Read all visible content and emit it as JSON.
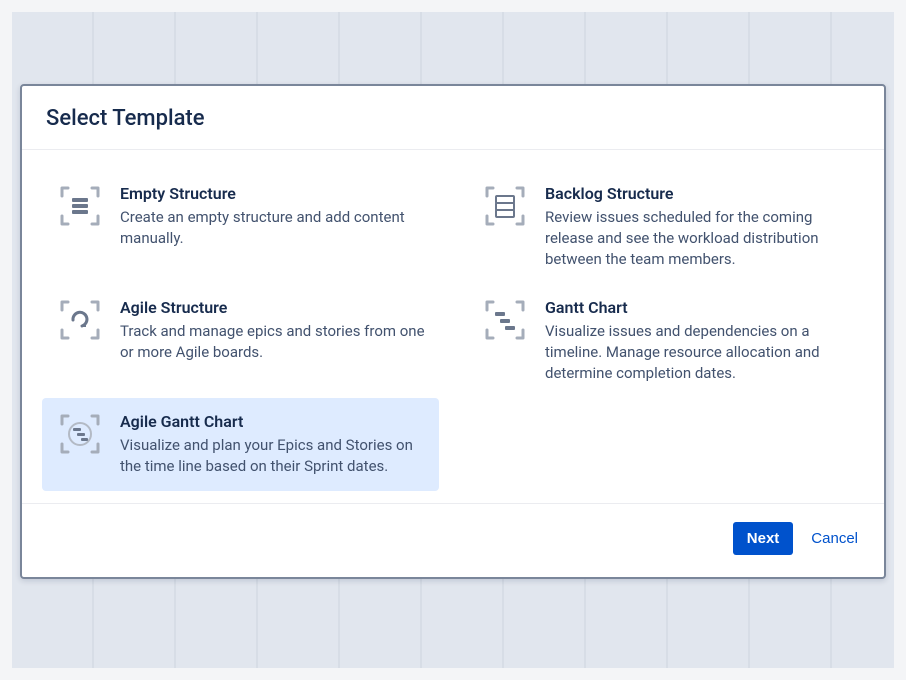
{
  "modal": {
    "title": "Select Template",
    "templates": [
      {
        "title": "Empty Structure",
        "desc": "Create an empty structure and add content manually.",
        "selected": false
      },
      {
        "title": "Backlog Structure",
        "desc": "Review issues scheduled for the coming release and see the workload distribution between the team members.",
        "selected": false
      },
      {
        "title": "Agile Structure",
        "desc": "Track and manage epics and stories from one or more Agile boards.",
        "selected": false
      },
      {
        "title": "Gantt Chart",
        "desc": "Visualize issues and dependencies on a timeline. Manage resource allocation and determine completion dates.",
        "selected": false
      },
      {
        "title": "Agile Gantt Chart",
        "desc": "Visualize and plan your Epics and Stories on the time line based on their Sprint dates.",
        "selected": true
      }
    ],
    "footer": {
      "next": "Next",
      "cancel": "Cancel"
    }
  },
  "colors": {
    "primary": "#0052cc",
    "selected_bg": "#deebff",
    "icon_stroke": "#a5adba",
    "icon_fill": "#6b778c"
  }
}
